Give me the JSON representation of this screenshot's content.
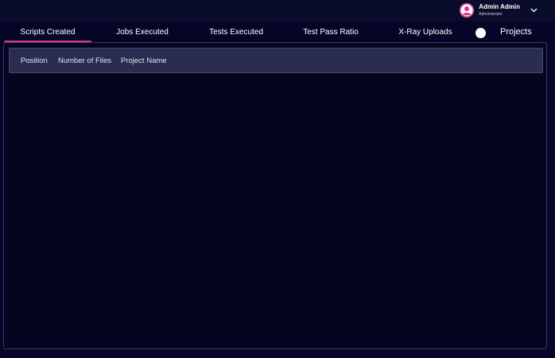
{
  "user": {
    "name": "Admin Admin",
    "role": "Administrator"
  },
  "tabs": [
    {
      "label": "Scripts Created",
      "active": true
    },
    {
      "label": "Jobs Executed",
      "active": false
    },
    {
      "label": "Tests Executed",
      "active": false
    },
    {
      "label": "Test Pass Ratio",
      "active": false
    },
    {
      "label": "X-Ray Uploads",
      "active": false
    }
  ],
  "projects_toggle_label": "Projects",
  "table": {
    "columns": [
      "Position",
      "Number of Files",
      "Project Name"
    ]
  },
  "colors": {
    "background": "#050627",
    "accent": "#e0338d",
    "header_row": "#2a2d4f"
  },
  "icons": {
    "avatar": "user-avatar-icon",
    "chevron": "chevron-down-icon"
  }
}
